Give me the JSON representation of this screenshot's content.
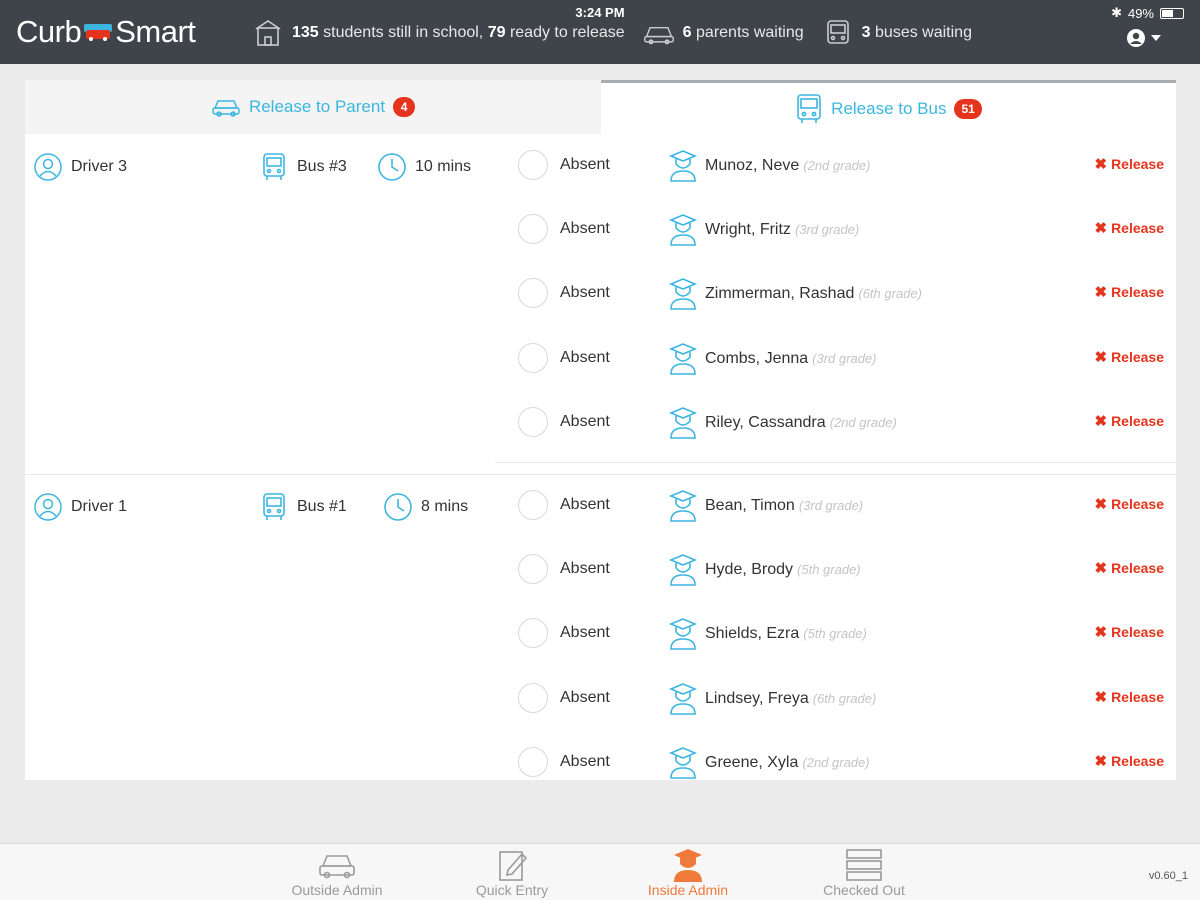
{
  "topbar": {
    "logo_left": "Curb",
    "logo_right": "Smart",
    "time": "3:24 PM",
    "battery": "49%",
    "battery_level": 0.49,
    "stats": {
      "in_school_count": "135",
      "in_school_text": "students still in school,",
      "ready_count": "79",
      "ready_text": "ready to release",
      "parents_count": "6",
      "parents_text": "parents waiting",
      "buses_count": "3",
      "buses_text": "buses waiting"
    }
  },
  "tabs": {
    "parent": {
      "label": "Release to Parent",
      "count": "4"
    },
    "bus": {
      "label": "Release to Bus",
      "count": "51"
    }
  },
  "groups": [
    {
      "driver": "Driver 3",
      "bus": "Bus #3",
      "time": "10 mins",
      "students": [
        {
          "status": "Absent",
          "name": "Munoz, Neve",
          "grade": "(2nd grade)",
          "action": "Release"
        },
        {
          "status": "Absent",
          "name": "Wright, Fritz",
          "grade": "(3rd grade)",
          "action": "Release"
        },
        {
          "status": "Absent",
          "name": "Zimmerman, Rashad",
          "grade": "(6th grade)",
          "action": "Release"
        },
        {
          "status": "Absent",
          "name": "Combs, Jenna",
          "grade": "(3rd grade)",
          "action": "Release"
        },
        {
          "status": "Absent",
          "name": "Riley, Cassandra",
          "grade": "(2nd grade)",
          "action": "Release"
        }
      ]
    },
    {
      "driver": "Driver 1",
      "bus": "Bus #1",
      "time": "8 mins",
      "students": [
        {
          "status": "Absent",
          "name": "Bean, Timon",
          "grade": "(3rd grade)",
          "action": "Release"
        },
        {
          "status": "Absent",
          "name": "Hyde, Brody",
          "grade": "(5th grade)",
          "action": "Release"
        },
        {
          "status": "Absent",
          "name": "Shields, Ezra",
          "grade": "(5th grade)",
          "action": "Release"
        },
        {
          "status": "Absent",
          "name": "Lindsey, Freya",
          "grade": "(6th grade)",
          "action": "Release"
        },
        {
          "status": "Absent",
          "name": "Greene, Xyla",
          "grade": "(2nd grade)",
          "action": "Release"
        }
      ]
    }
  ],
  "bottom_nav": [
    {
      "label": "Outside Admin",
      "icon": "car-icon"
    },
    {
      "label": "Quick Entry",
      "icon": "edit-icon"
    },
    {
      "label": "Inside Admin",
      "icon": "student-icon",
      "active": true
    },
    {
      "label": "Checked Out",
      "icon": "list-icon"
    }
  ],
  "version": "v0.60_1",
  "colors": {
    "accent": "#3cb6e0",
    "danger": "#e5341d",
    "active_nav": "#f07a3c",
    "topbar": "#3f444a"
  }
}
